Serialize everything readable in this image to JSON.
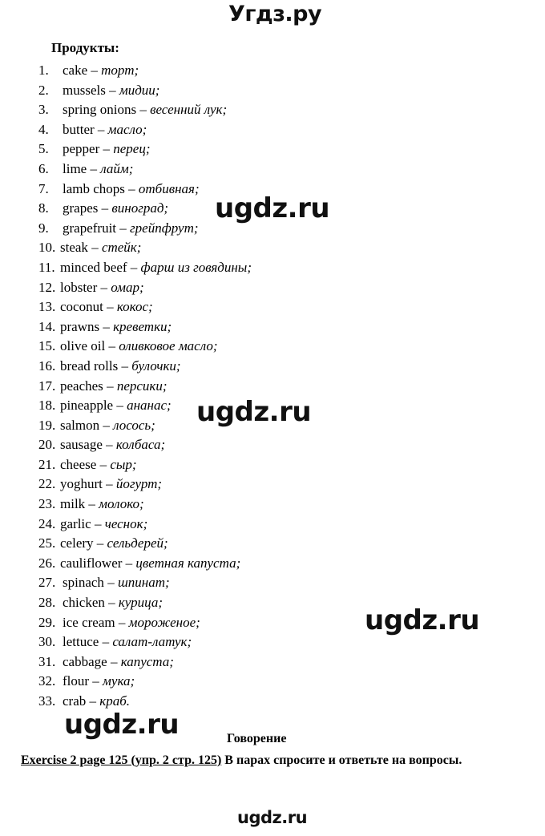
{
  "document": {
    "heading": "Продукты:",
    "section_title": "Говорение",
    "exercise": {
      "reference": "Exercise 2 page 125 (упр. 2 стр. 125)",
      "instruction": " В парах спросите и ответьте на вопросы."
    }
  },
  "watermarks": {
    "top": "Угдз.ру",
    "mid_1": "ugdz.ru",
    "mid_2": "ugdz.ru",
    "mid_3": "ugdz.ru",
    "mid_4": "ugdz.ru",
    "bottom": "ugdz.ru",
    "color": "#111111"
  },
  "vocabulary": [
    {
      "num": "1.",
      "en": "cake",
      "dash": "–",
      "ru": "торт;"
    },
    {
      "num": "2.",
      "en": "mussels",
      "dash": "–",
      "ru": "мидии;"
    },
    {
      "num": "3.",
      "en": "spring onions",
      "dash": "–",
      "ru": "весенний лук;"
    },
    {
      "num": "4.",
      "en": "butter",
      "dash": "–",
      "ru": "масло;"
    },
    {
      "num": "5.",
      "en": "pepper",
      "dash": "–",
      "ru": "перец;"
    },
    {
      "num": "6.",
      "en": "lime",
      "dash": "–",
      "ru": "лайм;"
    },
    {
      "num": "7.",
      "en": "lamb chops",
      "dash": "–",
      "ru": "отбивная;"
    },
    {
      "num": "8.",
      "en": "grapes",
      "dash": "–",
      "ru": "виноград;"
    },
    {
      "num": "9.",
      "en": "grapefruit",
      "dash": "–",
      "ru": "грейпфрут;"
    },
    {
      "num": "10.",
      "en": "steak",
      "dash": "–",
      "ru": "стейк;"
    },
    {
      "num": "11.",
      "en": "minced beef",
      "dash": "–",
      "ru": "фарш из говядины;"
    },
    {
      "num": "12.",
      "en": "lobster",
      "dash": "–",
      "ru": "омар;"
    },
    {
      "num": "13.",
      "en": "coconut",
      "dash": "–",
      "ru": "кокос;"
    },
    {
      "num": "14.",
      "en": "prawns",
      "dash": "–",
      "ru": "креветки;"
    },
    {
      "num": "15.",
      "en": "olive oil",
      "dash": "–",
      "ru": "оливковое масло;"
    },
    {
      "num": "16.",
      "en": "bread rolls",
      "dash": "–",
      "ru": "булочки;"
    },
    {
      "num": "17.",
      "en": "peaches",
      "dash": "–",
      "ru": "персики;"
    },
    {
      "num": "18.",
      "en": "pineapple",
      "dash": "–",
      "ru": "ананас;"
    },
    {
      "num": "19.",
      "en": "salmon",
      "dash": "–",
      "ru": "лосось;"
    },
    {
      "num": "20.",
      "en": "sausage",
      "dash": "–",
      "ru": "колбаса;"
    },
    {
      "num": "21.",
      "en": "cheese",
      "dash": "–",
      "ru": "сыр;"
    },
    {
      "num": "22.",
      "en": "yoghurt",
      "dash": "–",
      "ru": "йогурт;"
    },
    {
      "num": "23.",
      "en": "milk",
      "dash": "–",
      "ru": "молоко;"
    },
    {
      "num": "24.",
      "en": "garlic",
      "dash": "–",
      "ru": "чеснок;"
    },
    {
      "num": "25.",
      "en": "celery",
      "dash": "–",
      "ru": "сельдерей;"
    },
    {
      "num": "26.",
      "en": "cauliflower",
      "dash": "–",
      "ru": "цветная капуста;"
    },
    {
      "num": "27.",
      "en": "spinach",
      "dash": "–",
      "ru": "шпинат;"
    },
    {
      "num": "28.",
      "en": "chicken",
      "dash": "–",
      "ru": "курица;"
    },
    {
      "num": "29.",
      "en": "ice cream",
      "dash": "–",
      "ru": "мороженое;"
    },
    {
      "num": "30.",
      "en": "lettuce",
      "dash": "–",
      "ru": "салат-латук;"
    },
    {
      "num": "31.",
      "en": "cabbage",
      "dash": "–",
      "ru": "капуста;"
    },
    {
      "num": "32.",
      "en": "flour",
      "dash": "–",
      "ru": "мука;"
    },
    {
      "num": "33.",
      "en": "crab",
      "dash": "–",
      "ru": "краб."
    }
  ]
}
